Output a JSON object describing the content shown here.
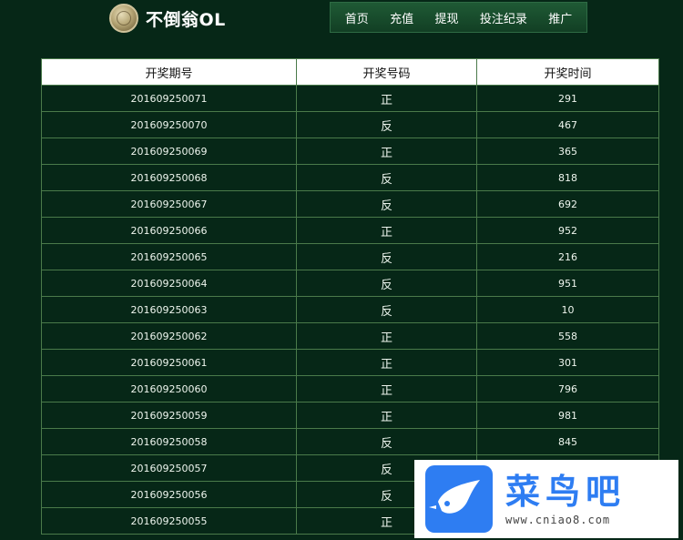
{
  "brand": {
    "name": "不倒翁OL"
  },
  "nav": {
    "items": [
      "首页",
      "充值",
      "提现",
      "投注纪录",
      "推广"
    ]
  },
  "table": {
    "headers": [
      "开奖期号",
      "开奖号码",
      "开奖时间"
    ],
    "rows": [
      [
        "201609250071",
        "正",
        "291"
      ],
      [
        "201609250070",
        "反",
        "467"
      ],
      [
        "201609250069",
        "正",
        "365"
      ],
      [
        "201609250068",
        "反",
        "818"
      ],
      [
        "201609250067",
        "反",
        "692"
      ],
      [
        "201609250066",
        "正",
        "952"
      ],
      [
        "201609250065",
        "反",
        "216"
      ],
      [
        "201609250064",
        "反",
        "951"
      ],
      [
        "201609250063",
        "反",
        "10"
      ],
      [
        "201609250062",
        "正",
        "558"
      ],
      [
        "201609250061",
        "正",
        "301"
      ],
      [
        "201609250060",
        "正",
        "796"
      ],
      [
        "201609250059",
        "正",
        "981"
      ],
      [
        "201609250058",
        "反",
        "845"
      ],
      [
        "201609250057",
        "反",
        ""
      ],
      [
        "201609250056",
        "反",
        ""
      ],
      [
        "201609250055",
        "正",
        ""
      ]
    ]
  },
  "watermark": {
    "title": "菜鸟吧",
    "url": "www.cniao8.com",
    "color": "#2e7df2"
  },
  "colors": {
    "background": "#062717",
    "nav": "#1f5a35",
    "border": "#4a7a4a"
  }
}
